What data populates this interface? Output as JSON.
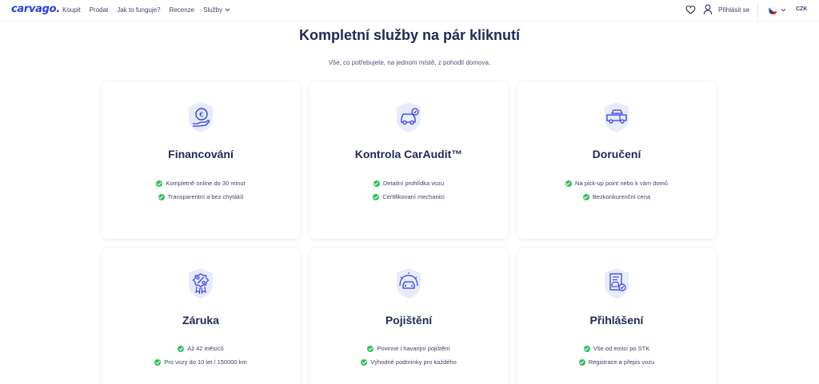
{
  "header": {
    "logo": "carvago.",
    "nav": [
      {
        "label": "Koupit"
      },
      {
        "label": "Prodat"
      },
      {
        "label": "Jak to funguje?"
      },
      {
        "label": "Recenze"
      },
      {
        "label": "Služby"
      }
    ],
    "login_label": "Přihlásit se",
    "currency": "CZK"
  },
  "main": {
    "title": "Kompletní služby na pár kliknutí",
    "subtitle": "Vše, co potřebujete, na jednom místě, z pohodlí domova."
  },
  "cards": [
    {
      "title": "Financování",
      "icon": "euro-hand-icon",
      "features": [
        "Kompletně online do 30 minut",
        "Transparentní a bez chytáků"
      ]
    },
    {
      "title": "Kontrola CarAudit™",
      "icon": "car-check-icon",
      "features": [
        "Detailní prohlídka vozu",
        "Certifikovaní mechanici"
      ]
    },
    {
      "title": "Doručení",
      "icon": "car-transporter-icon",
      "features": [
        "Na pick-up point nebo k vám domů",
        "Bezkonkurenční cena"
      ]
    },
    {
      "title": "Záruka",
      "icon": "warranty-badge-icon",
      "features": [
        "Až 42 měsíců",
        "Pro vozy do 10 let / 150000 km"
      ]
    },
    {
      "title": "Pojištění",
      "icon": "car-insurance-icon",
      "features": [
        "Povinné i havarijní pojištění",
        "Výhodné podmínky pro každého"
      ]
    },
    {
      "title": "Přihlášení",
      "icon": "registration-doc-icon",
      "features": [
        "Vše od emisí po STK",
        "Registrace a přepis vozu"
      ]
    }
  ],
  "colors": {
    "brand": "#2c3ee0",
    "text_dark": "#1f2a55",
    "check_green": "#2fbf5a",
    "icon_bg": "#e8ebfb"
  }
}
